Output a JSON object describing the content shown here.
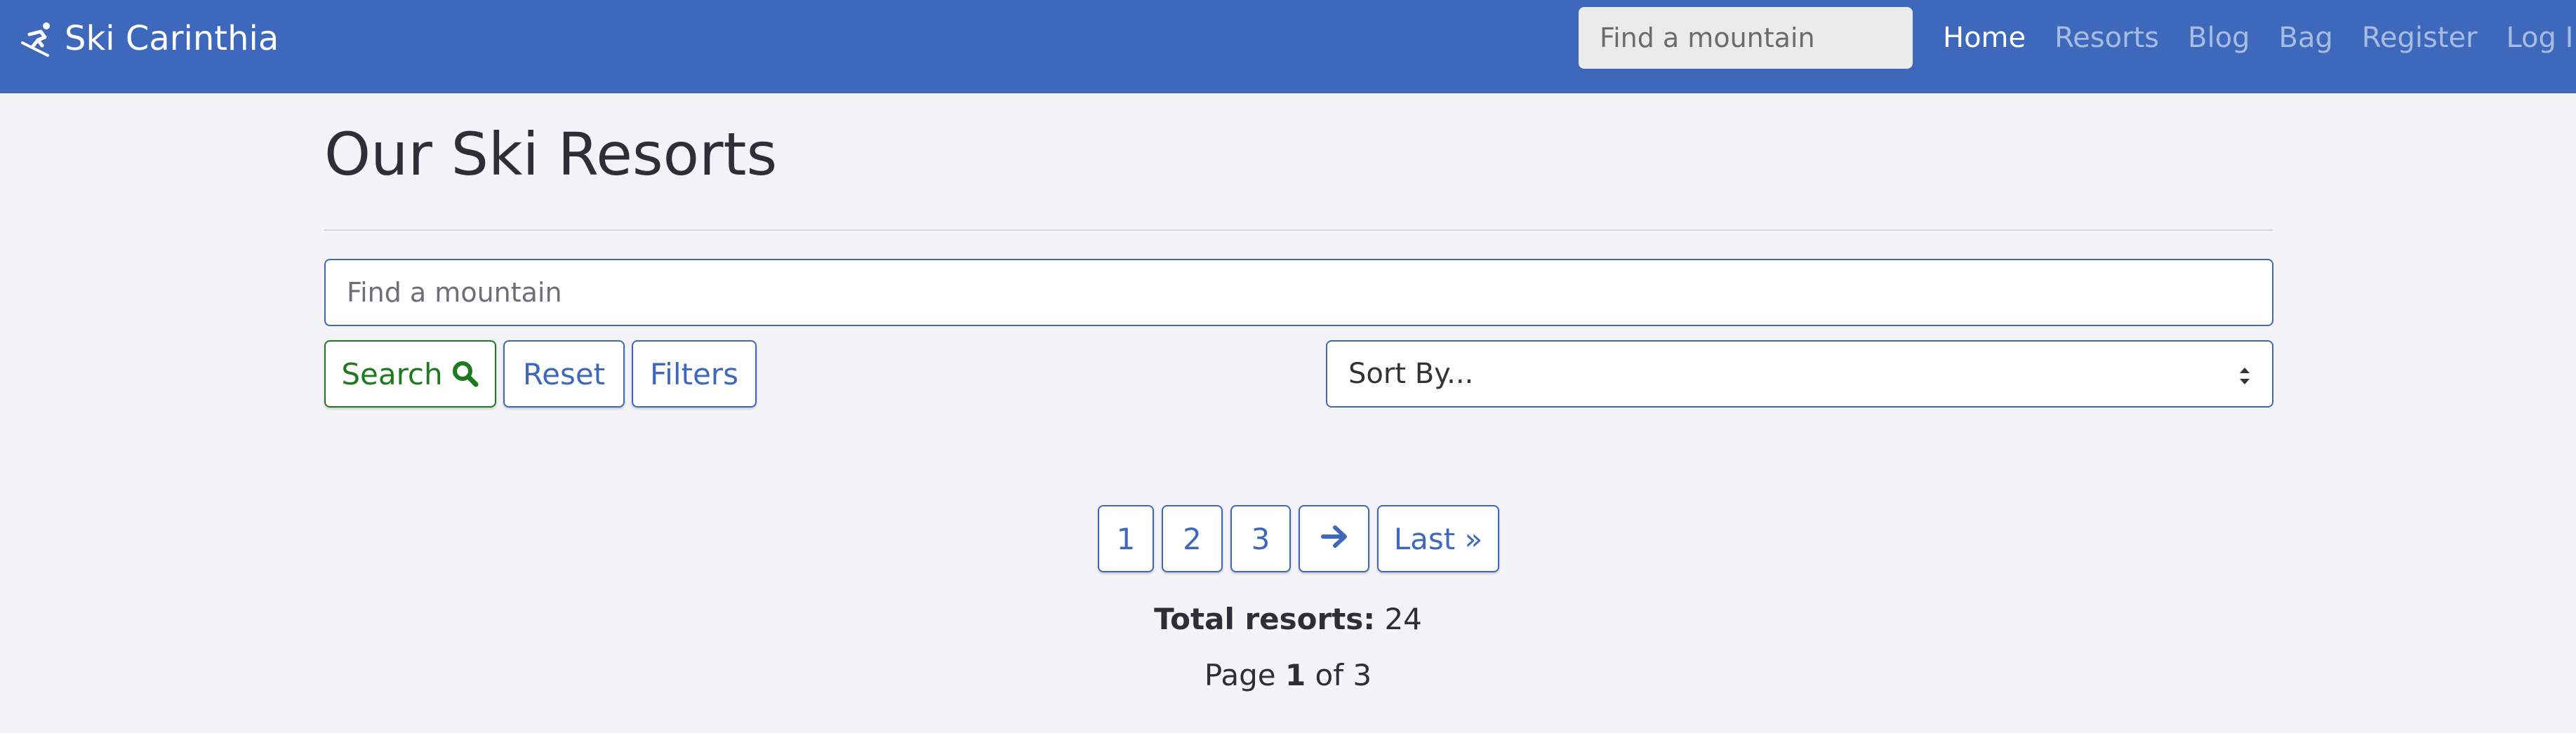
{
  "navbar": {
    "brand": "Ski Carinthia",
    "search_placeholder": "Find a mountain",
    "links": [
      {
        "label": "Home",
        "active": true
      },
      {
        "label": "Resorts",
        "active": false
      },
      {
        "label": "Blog",
        "active": false
      },
      {
        "label": "Bag",
        "active": false
      },
      {
        "label": "Register",
        "active": false
      },
      {
        "label": "Log In",
        "active": false
      }
    ]
  },
  "main": {
    "title": "Our Ski Resorts",
    "search_placeholder": "Find a mountain",
    "buttons": {
      "search": "Search",
      "reset": "Reset",
      "filters": "Filters"
    },
    "sort": {
      "selected": "Sort By..."
    }
  },
  "pagination": {
    "pages": [
      "1",
      "2",
      "3"
    ],
    "last": "Last »"
  },
  "summary": {
    "total_label": "Total resorts:",
    "total_value": "24",
    "page_prefix": "Page",
    "current_page": "1",
    "of_text": "of",
    "total_pages": "3"
  },
  "colors": {
    "navbar": "#3e68bb",
    "accent": "#3e68bb",
    "success": "#1e7a1e",
    "background": "#f3f3f8"
  },
  "icons": {
    "brand": "skier-icon",
    "search_button": "search-icon",
    "next_page": "arrow-right-icon",
    "sort": "sort-arrows-icon"
  }
}
